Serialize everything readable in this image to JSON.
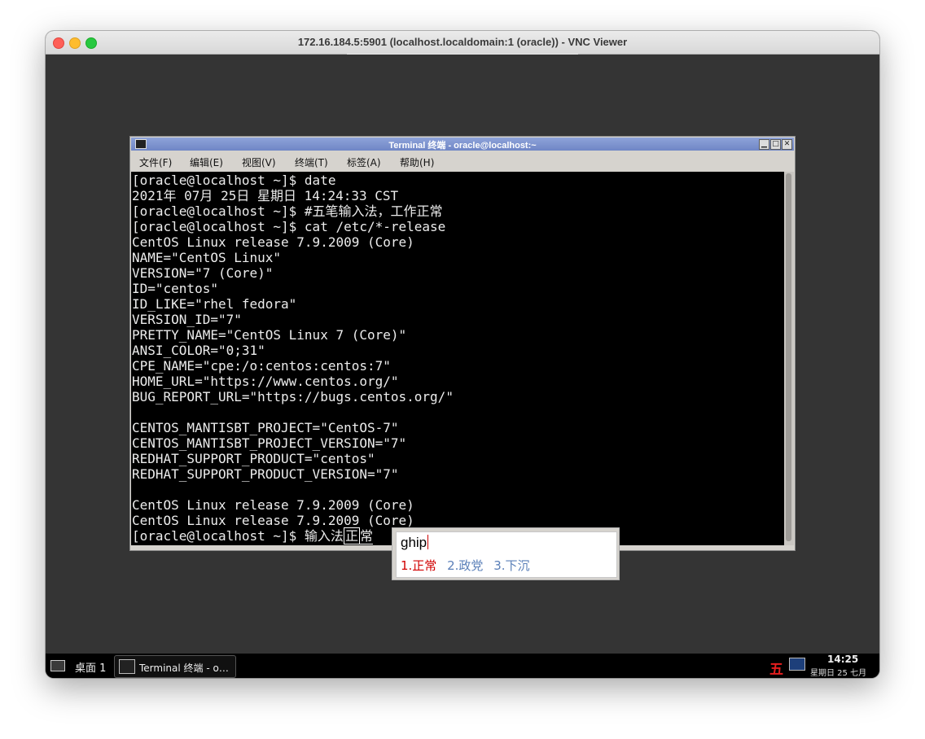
{
  "mac": {
    "title": "172.16.184.5:5901 (localhost.localdomain:1 (oracle)) - VNC Viewer"
  },
  "terminal": {
    "title": "Terminal 终端 - oracle@localhost:~",
    "menu": [
      "文件(F)",
      "编辑(E)",
      "视图(V)",
      "终端(T)",
      "标签(A)",
      "帮助(H)"
    ],
    "lines": [
      "[oracle@localhost ~]$ date",
      "2021年 07月 25日 星期日 14:24:33 CST",
      "[oracle@localhost ~]$ #五笔输入法，工作正常",
      "[oracle@localhost ~]$ cat /etc/*-release",
      "CentOS Linux release 7.9.2009 (Core)",
      "NAME=\"CentOS Linux\"",
      "VERSION=\"7 (Core)\"",
      "ID=\"centos\"",
      "ID_LIKE=\"rhel fedora\"",
      "VERSION_ID=\"7\"",
      "PRETTY_NAME=\"CentOS Linux 7 (Core)\"",
      "ANSI_COLOR=\"0;31\"",
      "CPE_NAME=\"cpe:/o:centos:centos:7\"",
      "HOME_URL=\"https://www.centos.org/\"",
      "BUG_REPORT_URL=\"https://bugs.centos.org/\"",
      "",
      "CENTOS_MANTISBT_PROJECT=\"CentOS-7\"",
      "CENTOS_MANTISBT_PROJECT_VERSION=\"7\"",
      "REDHAT_SUPPORT_PRODUCT=\"centos\"",
      "REDHAT_SUPPORT_PRODUCT_VERSION=\"7\"",
      "",
      "CentOS Linux release 7.9.2009 (Core)",
      "CentOS Linux release 7.9.2009 (Core)"
    ],
    "prompt_line": {
      "prompt": "[oracle@localhost ~]$ 输入法",
      "preedit_a": "正",
      "preedit_b": "常"
    }
  },
  "ime": {
    "code": "ghip",
    "candidates": [
      "1.正常",
      "2.政党",
      "3.下沉"
    ]
  },
  "taskbar": {
    "desktop": "桌面 1",
    "task": "Terminal 终端 - o…",
    "ime_indicator": "五",
    "time": "14:25",
    "date": "星期日 25 七月"
  }
}
